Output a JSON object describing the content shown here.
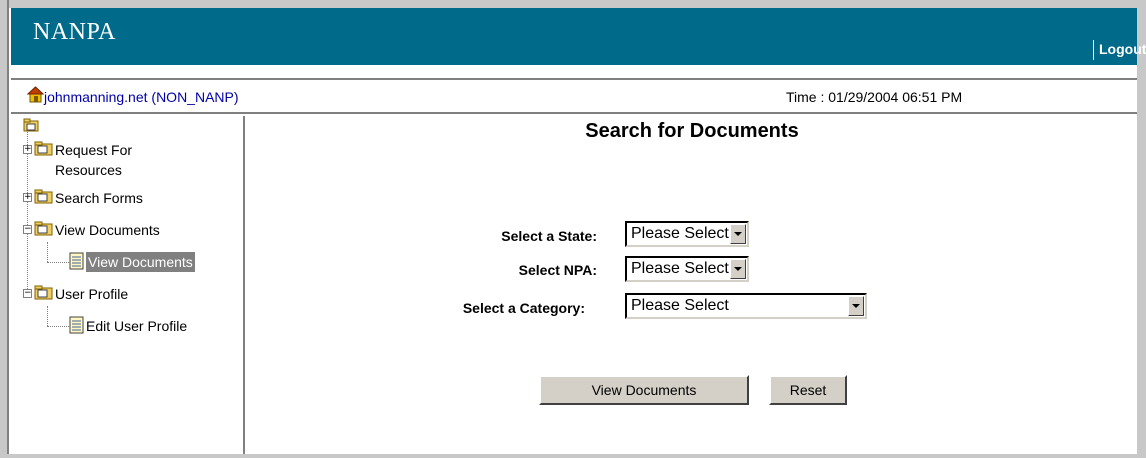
{
  "header": {
    "brand": "NANPA",
    "logout_label": "Logout"
  },
  "infobar": {
    "site_label": "johnmanning.net (NON_NANP)",
    "time_label": "Time : 01/29/2004 06:51 PM"
  },
  "sidebar": {
    "items": [
      {
        "label_line1": "Request For",
        "label_line2": "Resources",
        "toggle": "+"
      },
      {
        "label": "Search Forms",
        "toggle": "+"
      },
      {
        "label": "View Documents",
        "toggle": "−"
      },
      {
        "label": "View Documents",
        "selected": true
      },
      {
        "label": "User Profile",
        "toggle": "−"
      },
      {
        "label": "Edit User Profile"
      }
    ]
  },
  "main": {
    "title": "Search for Documents",
    "state_label": "Select a State:",
    "state_value": "Please Select",
    "npa_label": "Select NPA:",
    "npa_value": "Please Select",
    "category_label": "Select a Category:",
    "category_value": "Please Select",
    "view_button": "View Documents",
    "reset_button": "Reset"
  },
  "colors": {
    "header_bg": "#006a8a",
    "link": "#0000aa",
    "selected_bg": "#808080",
    "button_face": "#d4d0c8"
  },
  "icons": [
    "home-icon",
    "folder-icon",
    "document-icon"
  ]
}
